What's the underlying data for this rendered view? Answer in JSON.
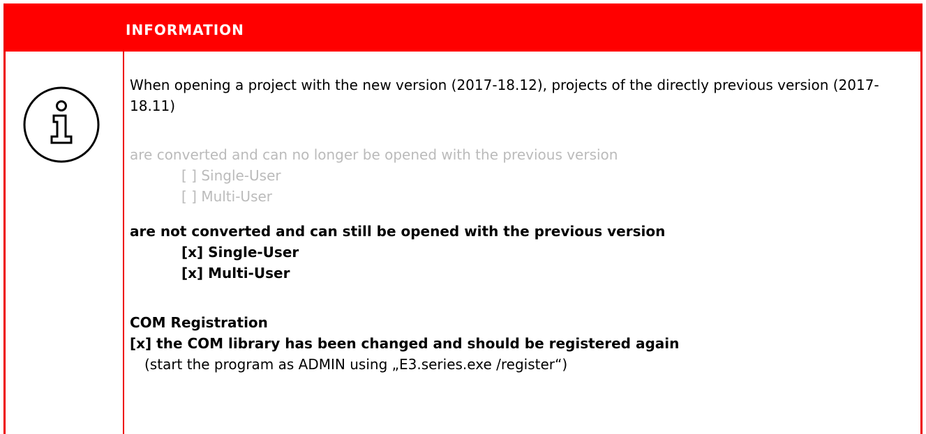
{
  "header": {
    "title": "INFORMATION"
  },
  "icon": {
    "name": "info-icon"
  },
  "intro": {
    "text": "When opening a project with the new version (2017-18.12), projects of the directly previous version (2017-18.11)"
  },
  "converted_option": {
    "text": "are converted and can no longer be opened with the previous version",
    "items": [
      "[  ] Single-User",
      "[  ] Multi-User"
    ]
  },
  "not_converted_option": {
    "text": "are not converted and can still be opened with the previous version",
    "items": [
      "[x] Single-User",
      "[x] Multi-User"
    ]
  },
  "com": {
    "title": "COM Registration",
    "item": "[x] the COM library has been changed and should be registered again",
    "note": "(start the program as ADMIN using „E3.series.exe /register“)"
  },
  "colors": {
    "accent": "#ff0000",
    "muted_text": "#bbbbbb"
  }
}
